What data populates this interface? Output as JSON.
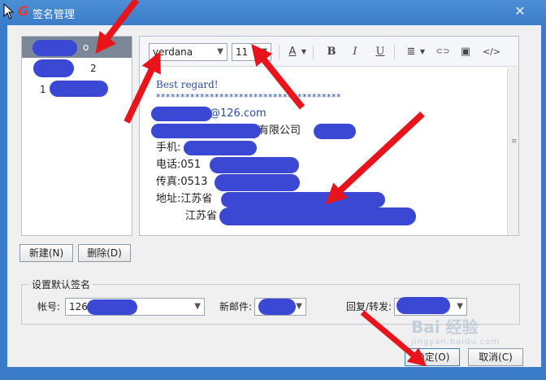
{
  "window": {
    "title": "签名管理",
    "close_glyph": "✕",
    "logo_glyph": "G"
  },
  "signature_list": {
    "items": [
      {
        "label": "o",
        "selected": true
      },
      {
        "label": "2",
        "selected": false
      },
      {
        "label": "1",
        "selected": false
      }
    ]
  },
  "editor": {
    "toolbar": {
      "font_family": "verdana",
      "font_size": "11",
      "font_color_glyph": "A",
      "bold_glyph": "B",
      "italic_glyph": "I",
      "underline_glyph": "U",
      "align_glyph": "≣",
      "link_glyph": "⊂⊃",
      "image_glyph": "▣",
      "source_glyph": "</>"
    },
    "content": {
      "greeting": "Best regard!",
      "separator": "**************************************",
      "email": "@126.com",
      "company": "有限公司",
      "mobile": "手机:",
      "phone": "电话:051",
      "fax": "传真:0513",
      "address_line1": "地址:江苏省",
      "address_line2": "江苏省"
    }
  },
  "buttons": {
    "new": "新建(N)",
    "delete": "删除(D)",
    "ok": "确定(O)",
    "cancel": "取消(C)"
  },
  "default_signature": {
    "legend": "设置默认签名",
    "account_label": "帐号:",
    "account_value": "126",
    "new_mail_label": "新邮件:",
    "reply_forward_label": "回复/转发:"
  },
  "watermark": {
    "text": "Bai 经验",
    "sub": "jingyan.baidu.com"
  },
  "colors": {
    "title_bar": "#3a7cc8",
    "selection": "#7b8796",
    "redaction": "#3a48d4",
    "annotation_arrow": "#e8141b"
  }
}
